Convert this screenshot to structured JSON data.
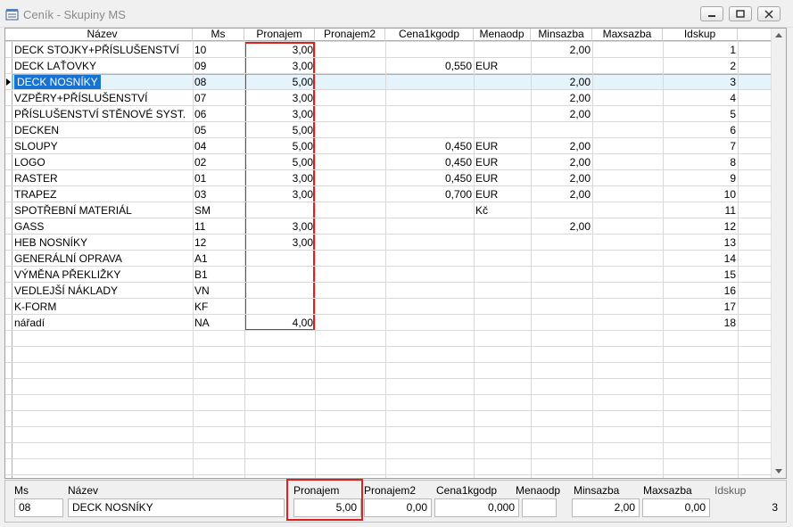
{
  "window": {
    "title": "Ceník - Skupiny MS",
    "app_icon": "notepad-app-icon",
    "controls": [
      "minimize-icon",
      "restore-icon",
      "close-icon"
    ]
  },
  "grid": {
    "columns": [
      "Název",
      "Ms",
      "Pronajem",
      "Pronajem2",
      "Cena1kgodp",
      "Menaodp",
      "Minsazba",
      "Maxsazba",
      "Idskup"
    ],
    "rows": [
      [
        "DECK STOJKY+PŘÍSLUŠENSTVÍ",
        "10",
        "3,00",
        "",
        "",
        "",
        "2,00",
        "",
        "1"
      ],
      [
        "DECK LAŤOVKY",
        "09",
        "3,00",
        "",
        "0,550",
        "EUR",
        "",
        "",
        "2"
      ],
      [
        "DECK NOSNÍKY",
        "08",
        "5,00",
        "",
        "",
        "",
        "2,00",
        "",
        "3"
      ],
      [
        "VZPĚRY+PŘÍSLUŠENSTVÍ",
        "07",
        "3,00",
        "",
        "",
        "",
        "2,00",
        "",
        "4"
      ],
      [
        "PŘÍSLUŠENSTVÍ STĚNOVÉ SYST.",
        "06",
        "3,00",
        "",
        "",
        "",
        "2,00",
        "",
        "5"
      ],
      [
        "DECKEN",
        "05",
        "5,00",
        "",
        "",
        "",
        "",
        "",
        "6"
      ],
      [
        "SLOUPY",
        "04",
        "5,00",
        "",
        "0,450",
        "EUR",
        "2,00",
        "",
        "7"
      ],
      [
        "LOGO",
        "02",
        "5,00",
        "",
        "0,450",
        "EUR",
        "2,00",
        "",
        "8"
      ],
      [
        "RASTER",
        "01",
        "3,00",
        "",
        "0,450",
        "EUR",
        "2,00",
        "",
        "9"
      ],
      [
        "TRAPEZ",
        "03",
        "3,00",
        "",
        "0,700",
        "EUR",
        "2,00",
        "",
        "10"
      ],
      [
        "SPOTŘEBNÍ MATERIÁL",
        "SM",
        "",
        "",
        "",
        "Kč",
        "",
        "",
        "11"
      ],
      [
        "GASS",
        "11",
        "3,00",
        "",
        "",
        "",
        "2,00",
        "",
        "12"
      ],
      [
        "HEB NOSNÍKY",
        "12",
        "3,00",
        "",
        "",
        "",
        "",
        "",
        "13"
      ],
      [
        "GENERÁLNÍ OPRAVA",
        "A1",
        "",
        "",
        "",
        "",
        "",
        "",
        "14"
      ],
      [
        "VÝMĚNA PŘEKLIŽKY",
        "B1",
        "",
        "",
        "",
        "",
        "",
        "",
        "15"
      ],
      [
        "VEDLEJŠÍ NÁKLADY",
        "VN",
        "",
        "",
        "",
        "",
        "",
        "",
        "16"
      ],
      [
        "K-FORM",
        "KF",
        "",
        "",
        "",
        "",
        "",
        "",
        "17"
      ],
      [
        "nářadí",
        "NA",
        "4,00",
        "",
        "",
        "",
        "",
        "",
        "18"
      ]
    ],
    "selected_row": 3
  },
  "detail": {
    "labels": {
      "ms": "Ms",
      "nazev": "Název",
      "pronajem": "Pronajem",
      "pronajem2": "Pronajem2",
      "cena1kgodp": "Cena1kgodp",
      "menaodp": "Menaodp",
      "minsazba": "Minsazba",
      "maxsazba": "Maxsazba",
      "idskup": "Idskup"
    },
    "values": {
      "ms": "08",
      "nazev": "DECK NOSNÍKY",
      "pronajem": "5,00",
      "pronajem2": "0,00",
      "cena1kgodp": "0,000",
      "menaodp": "",
      "minsazba": "2,00",
      "maxsazba": "0,00",
      "idskup": "3"
    }
  },
  "colors": {
    "highlight": "#e0201f",
    "selection": "#1773d2",
    "selected_row_bg": "#e5f3fb"
  }
}
